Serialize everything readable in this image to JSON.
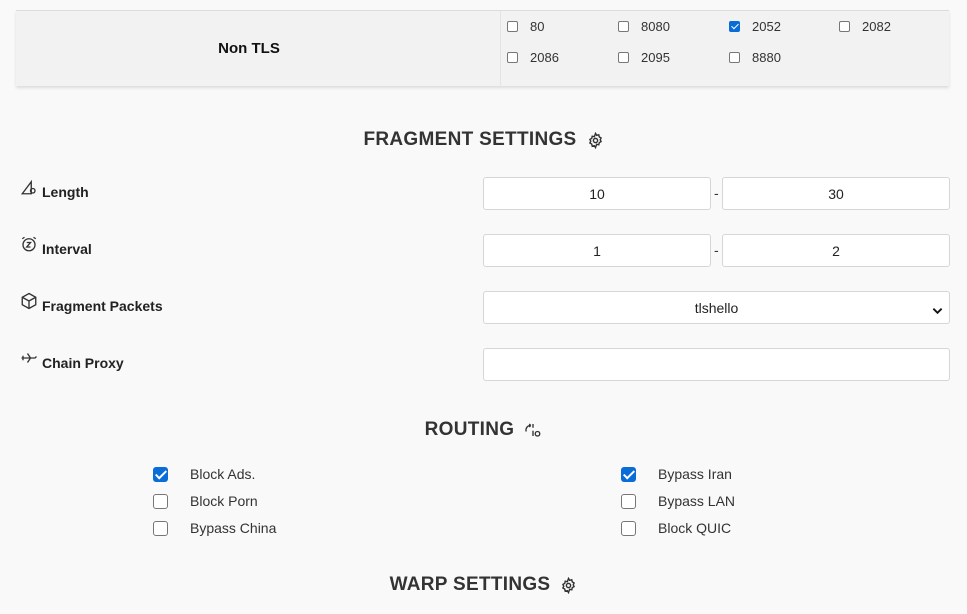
{
  "non_tls": {
    "label": "Non TLS",
    "ports": [
      {
        "value": "80",
        "checked": false
      },
      {
        "value": "8080",
        "checked": false
      },
      {
        "value": "2052",
        "checked": true
      },
      {
        "value": "2082",
        "checked": false
      },
      {
        "value": "2086",
        "checked": false
      },
      {
        "value": "2095",
        "checked": false
      },
      {
        "value": "8880",
        "checked": false
      }
    ]
  },
  "fragment": {
    "title": "FRAGMENT SETTINGS",
    "title_icon": "gear-icon",
    "length": {
      "label": "Length",
      "icon": "ruler-gear-icon",
      "min": "10",
      "max": "30"
    },
    "interval": {
      "label": "Interval",
      "icon": "alarm-clock-icon",
      "min": "1",
      "max": "2"
    },
    "packets": {
      "label": "Fragment Packets",
      "icon": "box-icon",
      "selected": "tlshello"
    },
    "chain_proxy": {
      "label": "Chain Proxy",
      "icon": "airplane-icon",
      "value": ""
    },
    "separator": "-"
  },
  "routing": {
    "title": "ROUTING",
    "title_icon": "route-gear-icon",
    "rules": [
      {
        "label": "Block Ads.",
        "checked": true
      },
      {
        "label": "Bypass Iran",
        "checked": true
      },
      {
        "label": "Block Porn",
        "checked": false
      },
      {
        "label": "Bypass LAN",
        "checked": false
      },
      {
        "label": "Bypass China",
        "checked": false
      },
      {
        "label": "Block QUIC",
        "checked": false
      }
    ]
  },
  "warp": {
    "title": "WARP SETTINGS",
    "title_icon": "gear-icon"
  },
  "colors": {
    "accent": "#0a6cd6",
    "background": "#f9f9f9",
    "panel": "#f2f2f2"
  }
}
